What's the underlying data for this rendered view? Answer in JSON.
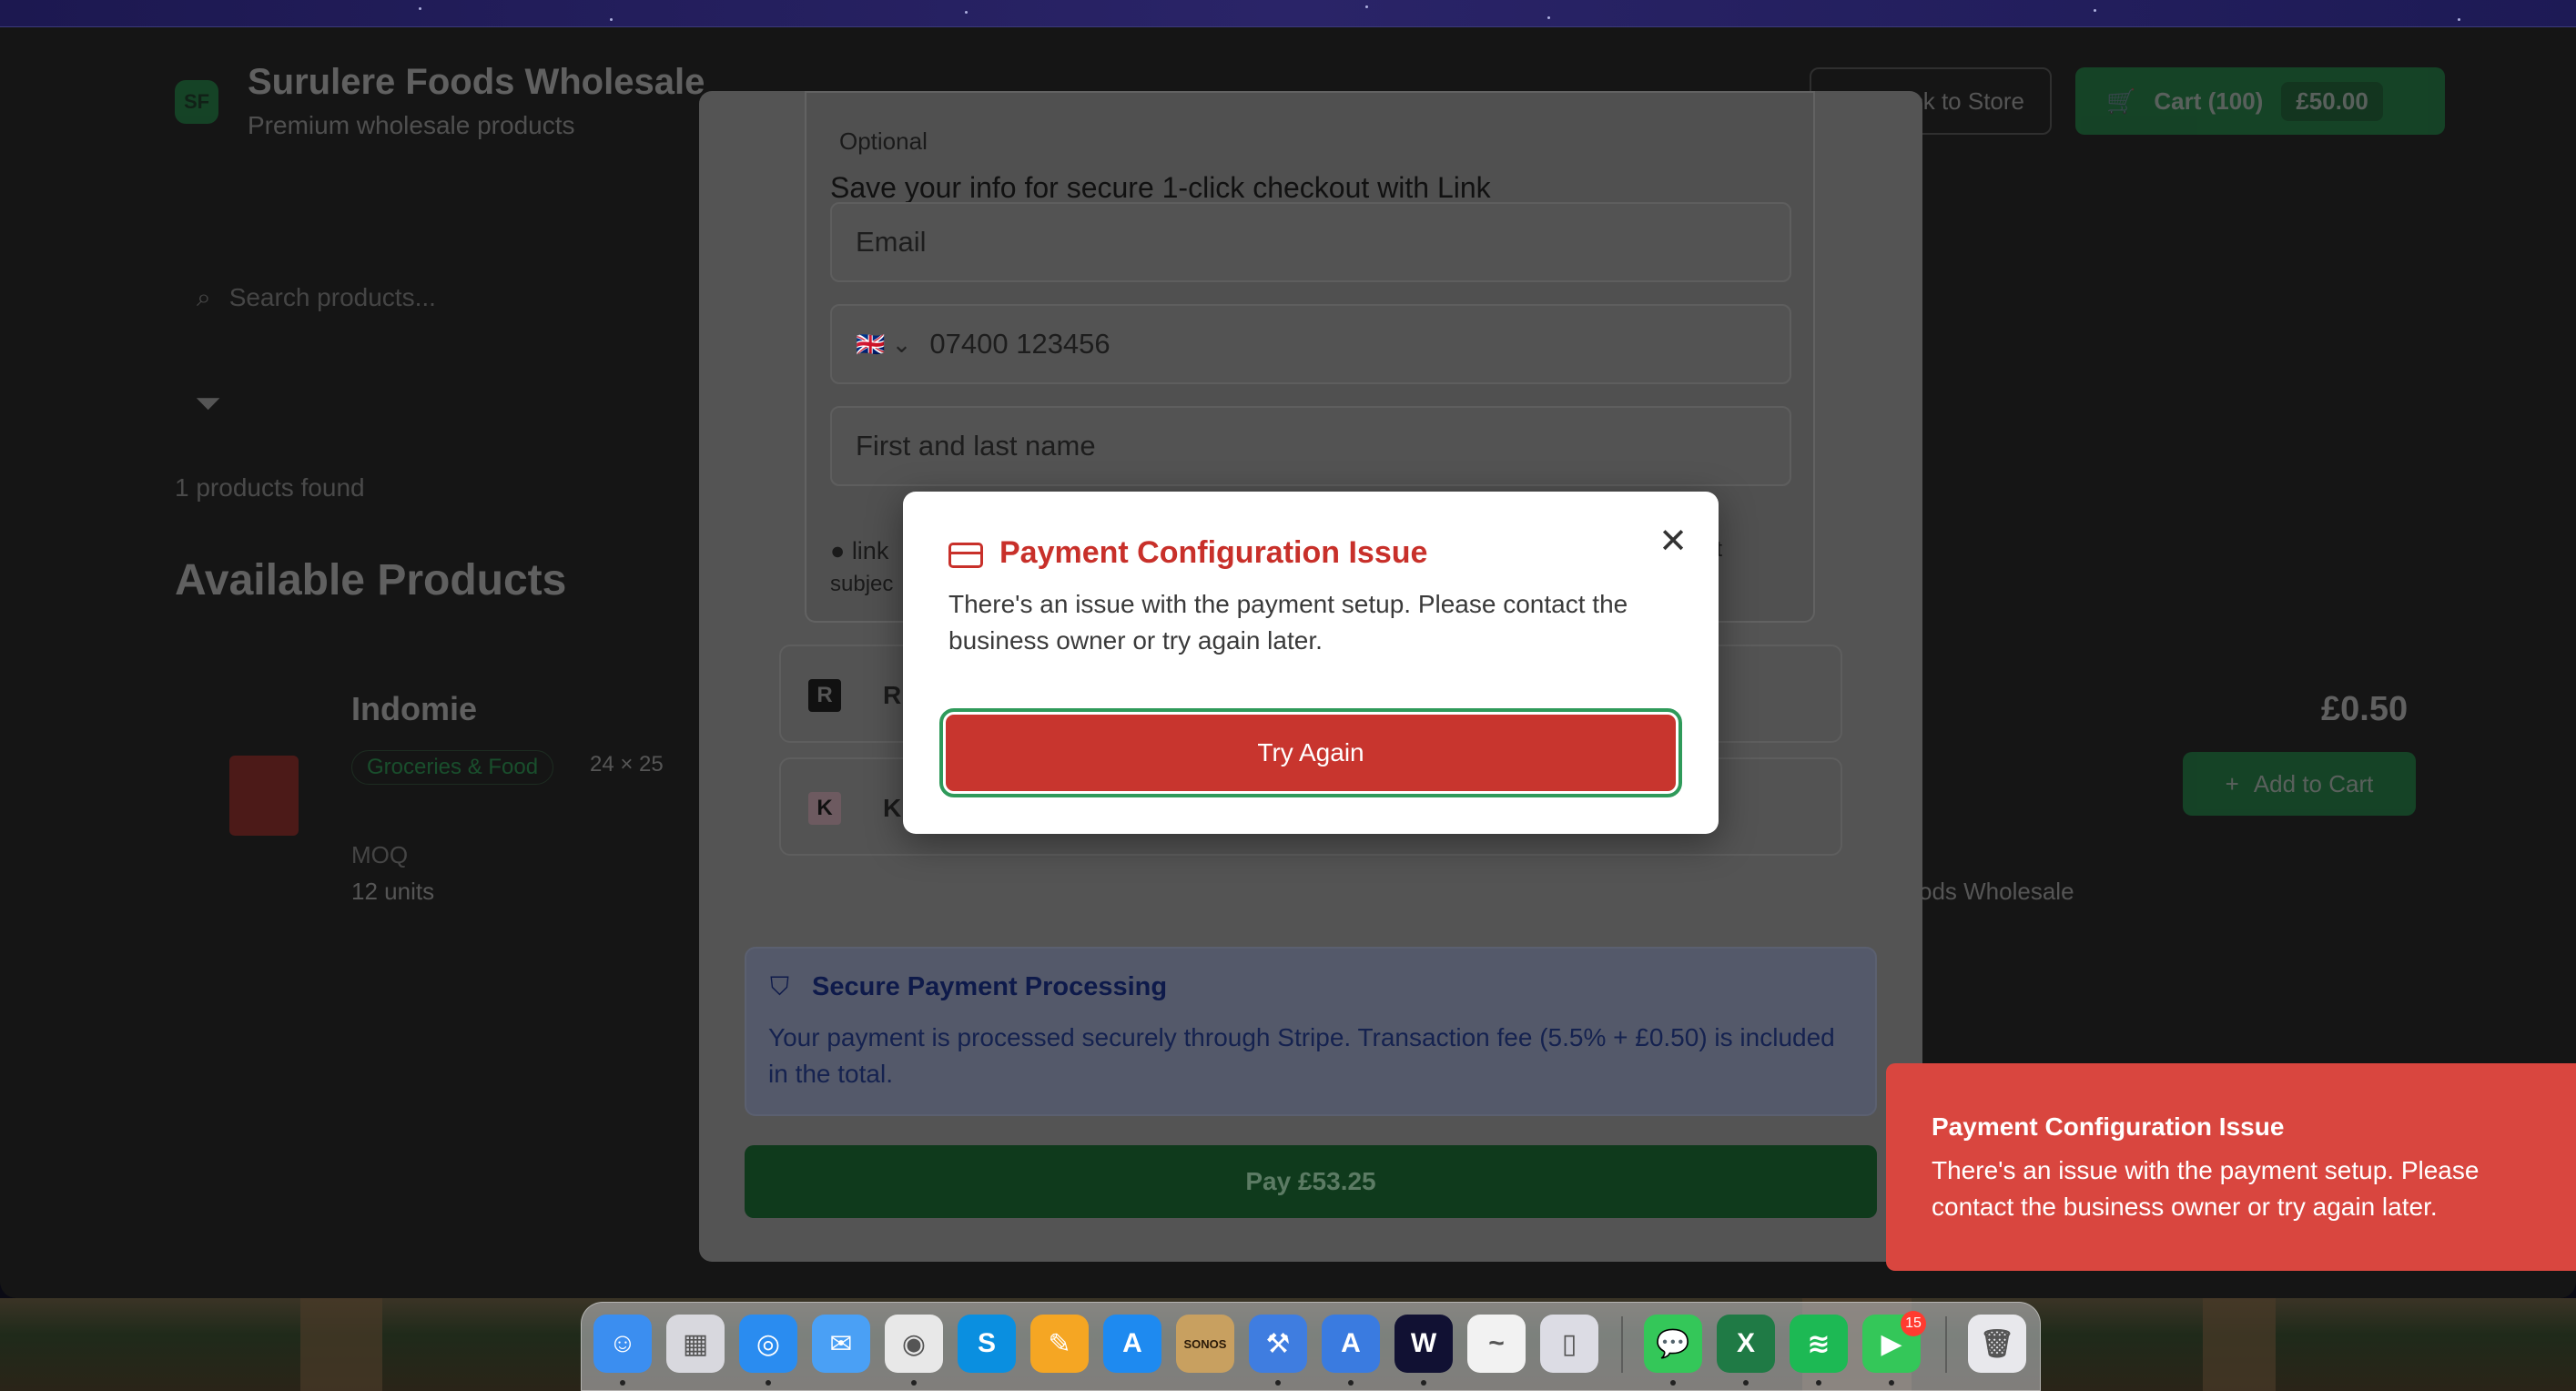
{
  "app": {
    "logo_initials": "SF",
    "title": "Surulere Foods Wholesale",
    "subtitle": "Premium wholesale products",
    "back_to_store": "ck to Store",
    "cart_label": "Cart (100)",
    "cart_total": "£50.00",
    "search_placeholder": "Search products...",
    "products_found": "1 products found",
    "available_heading": "Available Products",
    "product": {
      "name": "Indomie",
      "category": "Groceries & Food",
      "pack": "24 × 25",
      "moq_label": "MOQ",
      "units": "12 units",
      "price": "£0.50",
      "add_to_cart": "Add to Cart",
      "seller": "ods Wholesale"
    }
  },
  "checkout": {
    "optional_label": "Optional",
    "link_heading": "Save your info for secure 1-click checkout with Link",
    "email_placeholder": "Email",
    "phone_placeholder": "07400 123456",
    "name_placeholder": "First and last name",
    "link_brand": "link",
    "link_foot_cut": "subjec",
    "link_foot_right": "nt",
    "payment_options": [
      {
        "icon_letter": "R",
        "label": "R",
        "icon_color": "#111111"
      },
      {
        "icon_letter": "K",
        "label": "K",
        "icon_color": "#e8a6b8"
      }
    ],
    "secure_title": "Secure Payment Processing",
    "secure_text": "Your payment is processed securely through Stripe. Transaction fee (5.5% + £0.50) is included in the total.",
    "pay_button": "Pay £53.25"
  },
  "modal": {
    "icon": "credit-card-icon",
    "title": "Payment Configuration Issue",
    "text": "There's an issue with the payment setup. Please contact the business owner or try again later.",
    "try_again": "Try Again",
    "close_glyph": "✕"
  },
  "toast": {
    "title": "Payment Configuration Issue",
    "text": "There's an issue with the payment setup. Please contact the business owner or try again later."
  },
  "dock": {
    "facetime_badge": "15",
    "items": [
      {
        "name": "finder-icon",
        "color": "#3b8ef0",
        "glyph": "☺"
      },
      {
        "name": "launchpad-icon",
        "color": "#d8d8de",
        "glyph": "▦"
      },
      {
        "name": "safari-icon",
        "color": "#2a8cf0",
        "glyph": "◎"
      },
      {
        "name": "mail-icon",
        "color": "#4aa0f5",
        "glyph": "✉"
      },
      {
        "name": "chrome-icon",
        "color": "#e8e8e8",
        "glyph": "◉"
      },
      {
        "name": "skype-icon",
        "color": "#0a8fe0",
        "glyph": "S"
      },
      {
        "name": "pages-icon",
        "color": "#f5a623",
        "glyph": "✎"
      },
      {
        "name": "app-store-icon",
        "color": "#1e8af0",
        "glyph": "A"
      },
      {
        "name": "sonos-icon",
        "color": "#c8a060",
        "glyph": "SONOS"
      },
      {
        "name": "xcode-icon",
        "color": "#3f7de0",
        "glyph": "⚒"
      },
      {
        "name": "simulator-icon",
        "color": "#3a7be0",
        "glyph": "A"
      },
      {
        "name": "webex-icon",
        "color": "#111133",
        "glyph": "W"
      },
      {
        "name": "freeform-icon",
        "color": "#f2f2f2",
        "glyph": "~"
      },
      {
        "name": "iphone-mirroring-icon",
        "color": "#dcdce4",
        "glyph": "▯"
      },
      {
        "name": "messages-icon",
        "color": "#34c759",
        "glyph": "💬"
      },
      {
        "name": "excel-icon",
        "color": "#1f7a45",
        "glyph": "X"
      },
      {
        "name": "spotify-icon",
        "color": "#1db954",
        "glyph": "≋"
      },
      {
        "name": "facetime-icon",
        "color": "#34c759",
        "glyph": "▶"
      },
      {
        "name": "trash-icon",
        "color": "#e8e8ec",
        "glyph": "🗑"
      }
    ]
  }
}
